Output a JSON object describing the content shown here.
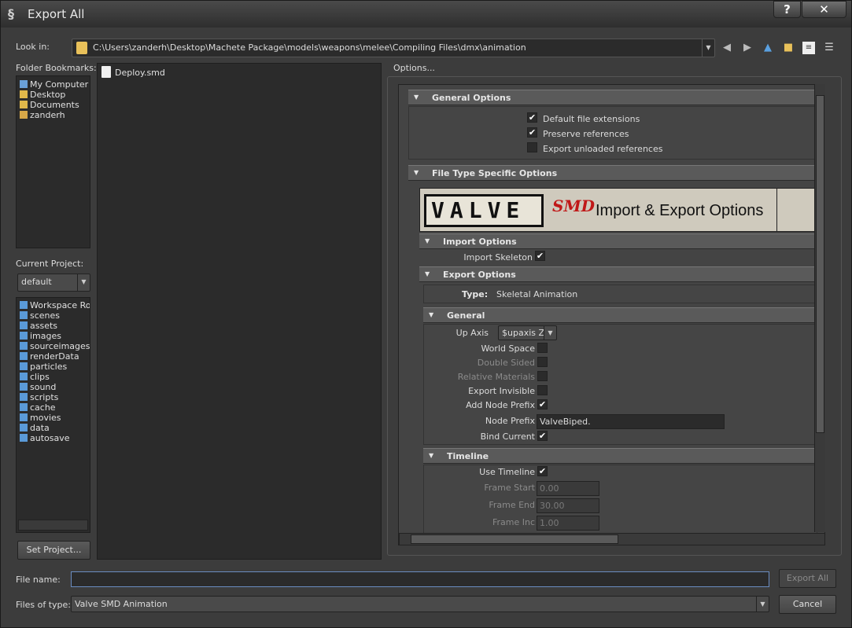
{
  "window": {
    "title": "Export All",
    "help_label": "?",
    "close_label": "✕"
  },
  "lookin": {
    "label": "Look in:",
    "path": "C:\\Users\\zanderh\\Desktop\\Machete Package\\models\\weapons\\melee\\Compiling Files\\dmx\\animation"
  },
  "bookmarks": {
    "label": "Folder Bookmarks:",
    "items": [
      {
        "label": "My Computer",
        "icon": "computer-icon"
      },
      {
        "label": "Desktop",
        "icon": "folder-icon"
      },
      {
        "label": "Documents",
        "icon": "folder-icon"
      },
      {
        "label": "zanderh",
        "icon": "user-folder-icon"
      }
    ]
  },
  "project": {
    "label": "Current Project:",
    "value": "default",
    "folders": [
      "Workspace Roo",
      "scenes",
      "assets",
      "images",
      "sourceimages",
      "renderData",
      "particles",
      "clips",
      "sound",
      "scripts",
      "cache",
      "movies",
      "data",
      "autosave"
    ],
    "set_button": "Set Project..."
  },
  "files": [
    {
      "name": "Deploy.smd"
    }
  ],
  "options": {
    "label": "Options...",
    "general": {
      "title": "General Options",
      "items": [
        {
          "label": "Default file extensions",
          "checked": true
        },
        {
          "label": "Preserve references",
          "checked": true
        },
        {
          "label": "Export unloaded references",
          "checked": false
        }
      ]
    },
    "filetype": {
      "title": "File Type Specific Options",
      "banner_valve": "VALVE",
      "banner_smd": "SMD",
      "banner_text": "Import & Export Options",
      "import_title": "Import Options",
      "import_skeleton": "Import Skeleton",
      "export_title": "Export Options",
      "type_label": "Type:",
      "type_value": "Skeletal Animation",
      "general_title": "General",
      "up_axis_label": "Up Axis",
      "up_axis_value": "$upaxis Z",
      "world_space": "World Space",
      "double_sided": "Double Sided",
      "relative_materials": "Relative Materials",
      "export_invisible": "Export Invisible",
      "add_node_prefix": "Add Node Prefix",
      "node_prefix_label": "Node Prefix",
      "node_prefix_value": "ValveBiped.",
      "bind_current": "Bind Current",
      "timeline_title": "Timeline",
      "use_timeline": "Use Timeline",
      "frame_start_label": "Frame Start",
      "frame_start": "0.00",
      "frame_end_label": "Frame End",
      "frame_end": "30.00",
      "frame_inc_label": "Frame Inc",
      "frame_inc": "1.00"
    }
  },
  "bottom": {
    "file_name_label": "File name:",
    "file_name_value": "",
    "files_of_type_label": "Files of type:",
    "files_of_type_value": "Valve SMD Animation",
    "export_button": "Export All",
    "cancel_button": "Cancel"
  }
}
